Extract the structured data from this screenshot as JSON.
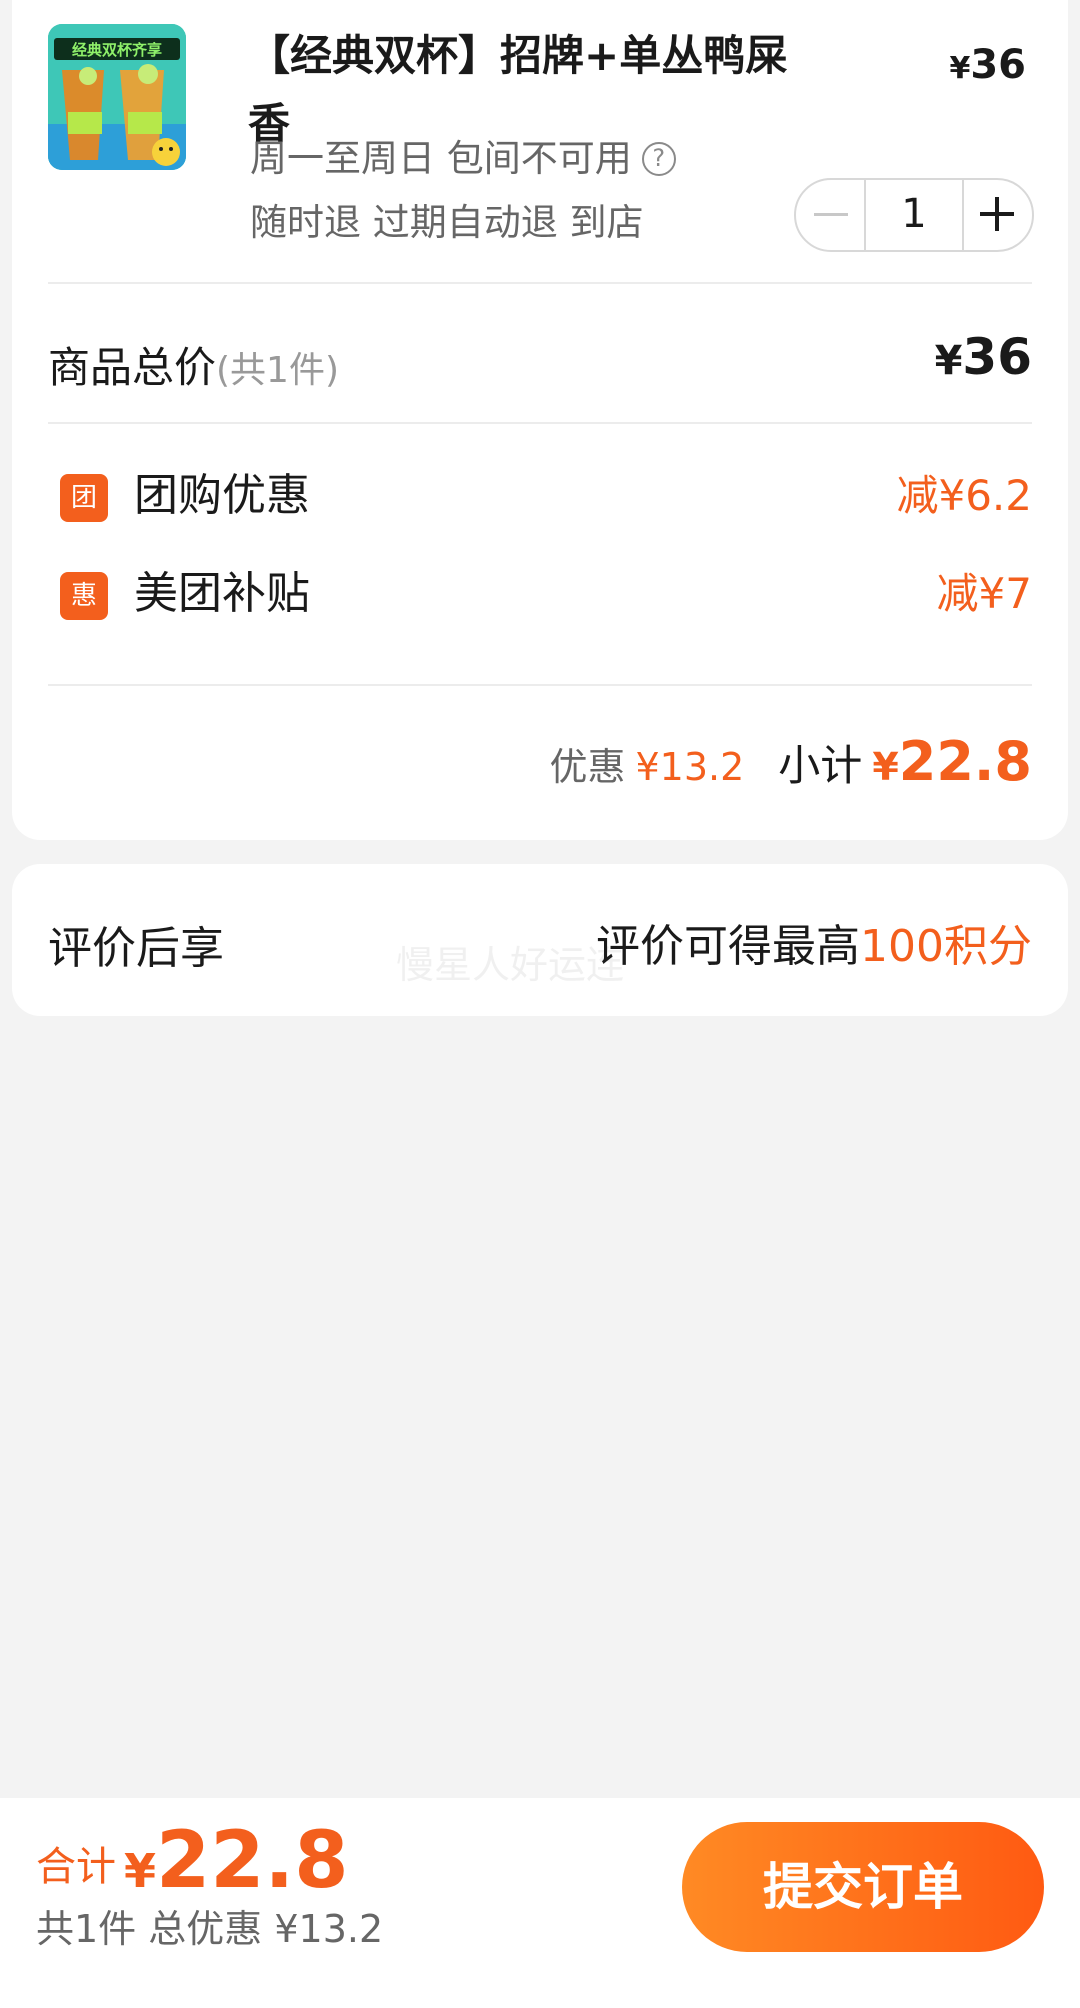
{
  "product": {
    "title": "【经典双杯】招牌+单丛鸭屎香",
    "price_symbol": "¥",
    "price": "36",
    "thumb_caption": "经典双杯齐享",
    "availability": "周一至周日 包间不可用",
    "help_icon": "question-circle-icon",
    "refund_policy": "随时退 过期自动退 到店",
    "quantity": "1"
  },
  "totals": {
    "label": "商品总价",
    "count": "(共1件)",
    "price_symbol": "¥",
    "price": "36"
  },
  "discounts": [
    {
      "badge": "团",
      "name": "团购优惠",
      "value": "减¥6.2"
    },
    {
      "badge": "惠",
      "name": "美团补贴",
      "value": "减¥7"
    }
  ],
  "summary": {
    "discount_label": "优惠",
    "discount_value": "¥13.2",
    "subtotal_label": "小计",
    "subtotal_symbol": "¥",
    "subtotal_value": "22.8"
  },
  "review": {
    "label": "评价后享",
    "text": "评价可得最高",
    "highlight": "100积分",
    "watermark": "慢星人好运连"
  },
  "footer": {
    "total_label": "合计",
    "total_symbol": "¥",
    "total_value": "22.8",
    "summary": "共1件 总优惠 ¥13.2",
    "submit_label": "提交订单"
  },
  "colors": {
    "accent": "#f35f1d",
    "button_gradient_start": "#ff8a24",
    "button_gradient_end": "#ff5a12",
    "background": "#f3f3f3"
  }
}
